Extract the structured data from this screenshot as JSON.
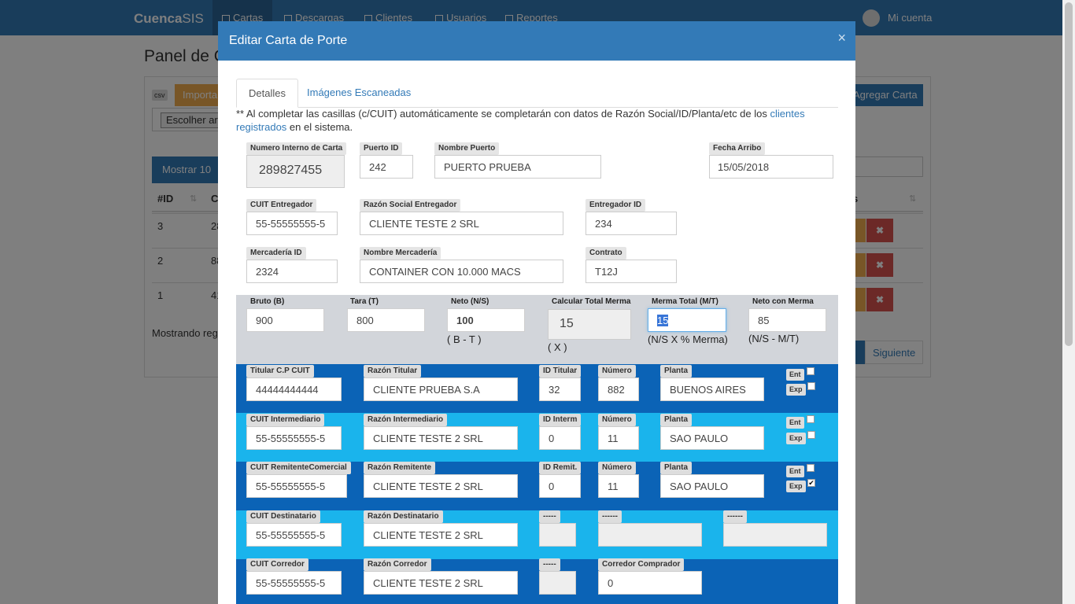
{
  "nav": {
    "brand_bold": "Cuenca",
    "brand_rest": "SIS",
    "items": [
      "Cartas",
      "Descargas",
      "Clientes",
      "Usuarios",
      "Reportes"
    ],
    "account": "Mi cuenta"
  },
  "background": {
    "title": "Panel de C",
    "csv": "csv",
    "import": "Importa",
    "file_button": "Escolher ar",
    "add_button": "Agregar Carta",
    "show": "Mostrar 10",
    "th_id": "#ID",
    "th_c": "C",
    "th_s": "s",
    "rows": [
      {
        "id": "3",
        "c": "28"
      },
      {
        "id": "2",
        "c": "88"
      },
      {
        "id": "1",
        "c": "41"
      }
    ],
    "showing": "Mostrando regi",
    "next": "Siguiente",
    "delete_icon": "✖"
  },
  "modal": {
    "title": "Editar Carta de Porte",
    "close": "×",
    "tabs": [
      "Detalles",
      "Imágenes Escaneadas"
    ],
    "info_pre": "** Al completar las casillas (c/CUIT) automáticamente se completarán con datos de Razón Social/ID/Planta/etc de los ",
    "info_link": "clientes registrados",
    "info_post": " en el sistema.",
    "row1": {
      "num_label": "Numero Interno de Carta",
      "num_value": "289827455",
      "puerto_id_label": "Puerto ID",
      "puerto_id_value": "242",
      "nombre_puerto_label": "Nombre Puerto",
      "nombre_puerto_value": "PUERTO PRUEBA",
      "fecha_label": "Fecha Arribo",
      "fecha_value": "15/05/2018"
    },
    "row2": {
      "cuit_label": "CUIT Entregador",
      "cuit_value": "55-55555555-5",
      "razon_label": "Razón Social Entregador",
      "razon_value": "CLIENTE TESTE 2 SRL",
      "id_label": "Entregador ID",
      "id_value": "234"
    },
    "row3": {
      "merc_id_label": "Mercadería ID",
      "merc_id_value": "2324",
      "merc_nombre_label": "Nombre Mercadería",
      "merc_nombre_value": "CONTAINER CON 10.000 MACS",
      "contrato_label": "Contrato",
      "contrato_value": "T12J"
    },
    "weights": {
      "bruto_label": "Bruto (B)",
      "bruto_value": "900",
      "tara_label": "Tara (T)",
      "tara_value": "800",
      "neto_label": "Neto (N/S)",
      "neto_value": "100",
      "neto_note": "( B - T )",
      "calc_label": "Calcular Total Merma",
      "calc_value": "15",
      "calc_note": "( X )",
      "merma_label": "Merma Total (M/T)",
      "merma_value": "15",
      "merma_note": "(N/S X % Merma)",
      "neto_merma_label": "Neto con Merma",
      "neto_merma_value": "85",
      "neto_merma_note": "(N/S - M/T)"
    },
    "ent": "Ent",
    "exp": "Exp",
    "check_mark": "✔",
    "titular": {
      "cuit_label": "Titular C.P CUIT",
      "cuit_value": "44444444444",
      "razon_label": "Razón Titular",
      "razon_value": "CLIENTE PRUEBA S.A",
      "id_label": "ID Titular",
      "id_value": "32",
      "num_label": "Número",
      "num_value": "882",
      "planta_label": "Planta",
      "planta_value": "BUENOS AIRES"
    },
    "intermediario": {
      "cuit_label": "CUIT Intermediario",
      "cuit_value": "55-55555555-5",
      "razon_label": "Razón Intermediario",
      "razon_value": "CLIENTE TESTE 2 SRL",
      "id_label": "ID Interm",
      "id_value": "0",
      "num_label": "Número",
      "num_value": "11",
      "planta_label": "Planta",
      "planta_value": "SAO PAULO"
    },
    "remitente": {
      "cuit_label": "CUIT RemitenteComercial",
      "cuit_value": "55-55555555-5",
      "razon_label": "Razón Remitente",
      "razon_value": "CLIENTE TESTE 2 SRL",
      "id_label": "ID Remit.",
      "id_value": "0",
      "num_label": "Número",
      "num_value": "11",
      "planta_label": "Planta",
      "planta_value": "SAO PAULO"
    },
    "destinatario": {
      "cuit_label": "CUIT Destinatario",
      "cuit_value": "55-55555555-5",
      "razon_label": "Razón Destinatario",
      "razon_value": "CLIENTE TESTE 2 SRL",
      "d1": "-----",
      "d2": "------",
      "d3": "------"
    },
    "corredor": {
      "cuit_label": "CUIT Corredor",
      "cuit_value": "55-55555555-5",
      "razon_label": "Razón Corredor",
      "razon_value": "CLIENTE TESTE 2 SRL",
      "d1": "-----",
      "comprador_label": "Corredor Comprador",
      "comprador_value": "0"
    }
  }
}
